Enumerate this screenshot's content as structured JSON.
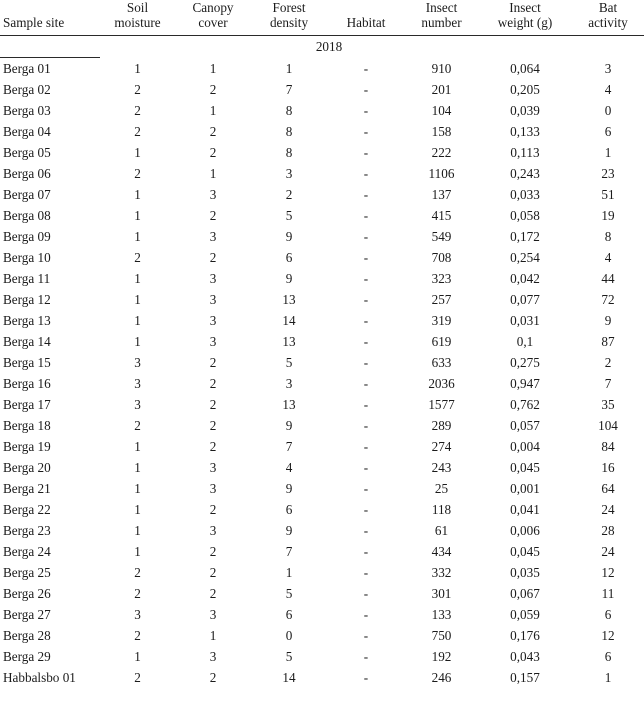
{
  "table": {
    "columns": [
      {
        "key": "site",
        "label_lines": [
          "Sample site"
        ],
        "align": "left"
      },
      {
        "key": "soil",
        "label_lines": [
          "Soil",
          "moisture"
        ],
        "align": "center"
      },
      {
        "key": "canopy",
        "label_lines": [
          "Canopy",
          "cover"
        ],
        "align": "center"
      },
      {
        "key": "forest",
        "label_lines": [
          "Forest",
          "density"
        ],
        "align": "center"
      },
      {
        "key": "habitat",
        "label_lines": [
          "Habitat"
        ],
        "align": "center"
      },
      {
        "key": "insect_n",
        "label_lines": [
          "Insect",
          "number"
        ],
        "align": "center"
      },
      {
        "key": "insect_w",
        "label_lines": [
          "Insect",
          "weight (g)"
        ],
        "align": "center"
      },
      {
        "key": "bat",
        "label_lines": [
          "Bat",
          "activity"
        ],
        "align": "center"
      }
    ],
    "group_label": "2018",
    "rows": [
      {
        "site": "Berga 01",
        "soil": "1",
        "canopy": "1",
        "forest": "1",
        "habitat": "-",
        "insect_n": "910",
        "insect_w": "0,064",
        "bat": "3"
      },
      {
        "site": "Berga 02",
        "soil": "2",
        "canopy": "2",
        "forest": "7",
        "habitat": "-",
        "insect_n": "201",
        "insect_w": "0,205",
        "bat": "4"
      },
      {
        "site": "Berga 03",
        "soil": "2",
        "canopy": "1",
        "forest": "8",
        "habitat": "-",
        "insect_n": "104",
        "insect_w": "0,039",
        "bat": "0"
      },
      {
        "site": "Berga 04",
        "soil": "2",
        "canopy": "2",
        "forest": "8",
        "habitat": "-",
        "insect_n": "158",
        "insect_w": "0,133",
        "bat": "6"
      },
      {
        "site": "Berga 05",
        "soil": "1",
        "canopy": "2",
        "forest": "8",
        "habitat": "-",
        "insect_n": "222",
        "insect_w": "0,113",
        "bat": "1"
      },
      {
        "site": "Berga 06",
        "soil": "2",
        "canopy": "1",
        "forest": "3",
        "habitat": "-",
        "insect_n": "1106",
        "insect_w": "0,243",
        "bat": "23"
      },
      {
        "site": "Berga 07",
        "soil": "1",
        "canopy": "3",
        "forest": "2",
        "habitat": "-",
        "insect_n": "137",
        "insect_w": "0,033",
        "bat": "51"
      },
      {
        "site": "Berga 08",
        "soil": "1",
        "canopy": "2",
        "forest": "5",
        "habitat": "-",
        "insect_n": "415",
        "insect_w": "0,058",
        "bat": "19"
      },
      {
        "site": "Berga 09",
        "soil": "1",
        "canopy": "3",
        "forest": "9",
        "habitat": "-",
        "insect_n": "549",
        "insect_w": "0,172",
        "bat": "8"
      },
      {
        "site": "Berga 10",
        "soil": "2",
        "canopy": "2",
        "forest": "6",
        "habitat": "-",
        "insect_n": "708",
        "insect_w": "0,254",
        "bat": "4"
      },
      {
        "site": "Berga 11",
        "soil": "1",
        "canopy": "3",
        "forest": "9",
        "habitat": "-",
        "insect_n": "323",
        "insect_w": "0,042",
        "bat": "44"
      },
      {
        "site": "Berga 12",
        "soil": "1",
        "canopy": "3",
        "forest": "13",
        "habitat": "-",
        "insect_n": "257",
        "insect_w": "0,077",
        "bat": "72"
      },
      {
        "site": "Berga 13",
        "soil": "1",
        "canopy": "3",
        "forest": "14",
        "habitat": "-",
        "insect_n": "319",
        "insect_w": "0,031",
        "bat": "9"
      },
      {
        "site": "Berga 14",
        "soil": "1",
        "canopy": "3",
        "forest": "13",
        "habitat": "-",
        "insect_n": "619",
        "insect_w": "0,1",
        "bat": "87"
      },
      {
        "site": "Berga 15",
        "soil": "3",
        "canopy": "2",
        "forest": "5",
        "habitat": "-",
        "insect_n": "633",
        "insect_w": "0,275",
        "bat": "2"
      },
      {
        "site": "Berga 16",
        "soil": "3",
        "canopy": "2",
        "forest": "3",
        "habitat": "-",
        "insect_n": "2036",
        "insect_w": "0,947",
        "bat": "7"
      },
      {
        "site": "Berga 17",
        "soil": "3",
        "canopy": "2",
        "forest": "13",
        "habitat": "-",
        "insect_n": "1577",
        "insect_w": "0,762",
        "bat": "35"
      },
      {
        "site": "Berga 18",
        "soil": "2",
        "canopy": "2",
        "forest": "9",
        "habitat": "-",
        "insect_n": "289",
        "insect_w": "0,057",
        "bat": "104"
      },
      {
        "site": "Berga 19",
        "soil": "1",
        "canopy": "2",
        "forest": "7",
        "habitat": "-",
        "insect_n": "274",
        "insect_w": "0,004",
        "bat": "84"
      },
      {
        "site": "Berga 20",
        "soil": "1",
        "canopy": "3",
        "forest": "4",
        "habitat": "-",
        "insect_n": "243",
        "insect_w": "0,045",
        "bat": "16"
      },
      {
        "site": "Berga 21",
        "soil": "1",
        "canopy": "3",
        "forest": "9",
        "habitat": "-",
        "insect_n": "25",
        "insect_w": "0,001",
        "bat": "64"
      },
      {
        "site": "Berga 22",
        "soil": "1",
        "canopy": "2",
        "forest": "6",
        "habitat": "-",
        "insect_n": "118",
        "insect_w": "0,041",
        "bat": "24"
      },
      {
        "site": "Berga 23",
        "soil": "1",
        "canopy": "3",
        "forest": "9",
        "habitat": "-",
        "insect_n": "61",
        "insect_w": "0,006",
        "bat": "28"
      },
      {
        "site": "Berga 24",
        "soil": "1",
        "canopy": "2",
        "forest": "7",
        "habitat": "-",
        "insect_n": "434",
        "insect_w": "0,045",
        "bat": "24"
      },
      {
        "site": "Berga 25",
        "soil": "2",
        "canopy": "2",
        "forest": "1",
        "habitat": "-",
        "insect_n": "332",
        "insect_w": "0,035",
        "bat": "12"
      },
      {
        "site": "Berga 26",
        "soil": "2",
        "canopy": "2",
        "forest": "5",
        "habitat": "-",
        "insect_n": "301",
        "insect_w": "0,067",
        "bat": "11"
      },
      {
        "site": "Berga 27",
        "soil": "3",
        "canopy": "3",
        "forest": "6",
        "habitat": "-",
        "insect_n": "133",
        "insect_w": "0,059",
        "bat": "6"
      },
      {
        "site": "Berga 28",
        "soil": "2",
        "canopy": "1",
        "forest": "0",
        "habitat": "-",
        "insect_n": "750",
        "insect_w": "0,176",
        "bat": "12"
      },
      {
        "site": "Berga 29",
        "soil": "1",
        "canopy": "3",
        "forest": "5",
        "habitat": "-",
        "insect_n": "192",
        "insect_w": "0,043",
        "bat": "6"
      },
      {
        "site": "Habbalsbo 01",
        "soil": "2",
        "canopy": "2",
        "forest": "14",
        "habitat": "-",
        "insect_n": "246",
        "insect_w": "0,157",
        "bat": "1"
      }
    ]
  }
}
